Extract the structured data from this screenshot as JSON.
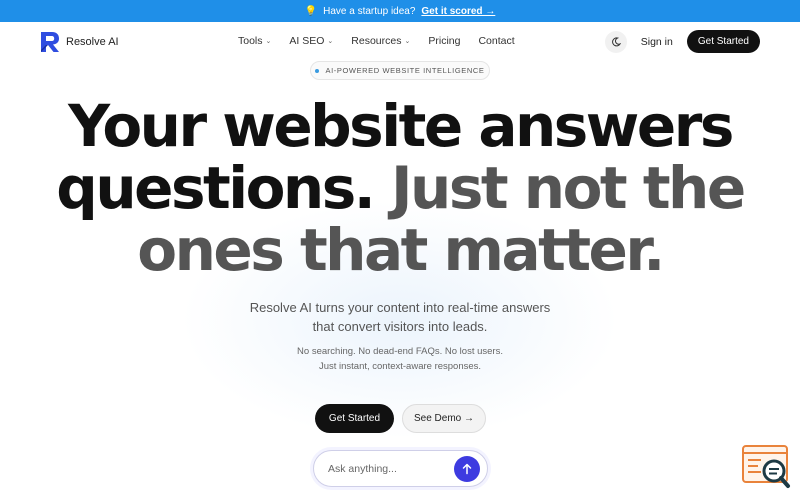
{
  "announcement": {
    "icon": "lightbulb-icon",
    "text": "Have a startup idea?",
    "link": "Get it scored →"
  },
  "brand": {
    "name": "Resolve AI",
    "color": "#2f4de0"
  },
  "nav": {
    "items": [
      {
        "label": "Tools",
        "dropdown": true
      },
      {
        "label": "AI SEO",
        "dropdown": true
      },
      {
        "label": "Resources",
        "dropdown": true
      },
      {
        "label": "Pricing",
        "dropdown": false
      },
      {
        "label": "Contact",
        "dropdown": false
      }
    ],
    "theme_icon": "moon-icon",
    "signin": "Sign in",
    "cta": "Get Started"
  },
  "tag": "AI-POWERED WEBSITE INTELLIGENCE",
  "hero": {
    "line1": "Your website answers",
    "line2_dark": "questions.",
    "line2_grey": "Just not the",
    "line3_grey": "ones that matter."
  },
  "subheadline": {
    "line1": "Resolve AI turns your content into real-time answers",
    "line2": "that convert visitors into leads."
  },
  "small": {
    "line1": "No searching. No dead-end FAQs. No lost users.",
    "line2": "Just instant, context-aware responses."
  },
  "buttons": {
    "primary": "Get Started",
    "secondary": "See Demo →"
  },
  "ask": {
    "placeholder": "Ask anything...",
    "send_icon": "arrow-up-icon"
  },
  "colors": {
    "announcement_bg": "#1f8fe8",
    "send_button": "#3d3be0",
    "widget_accent": "#e9833b"
  }
}
